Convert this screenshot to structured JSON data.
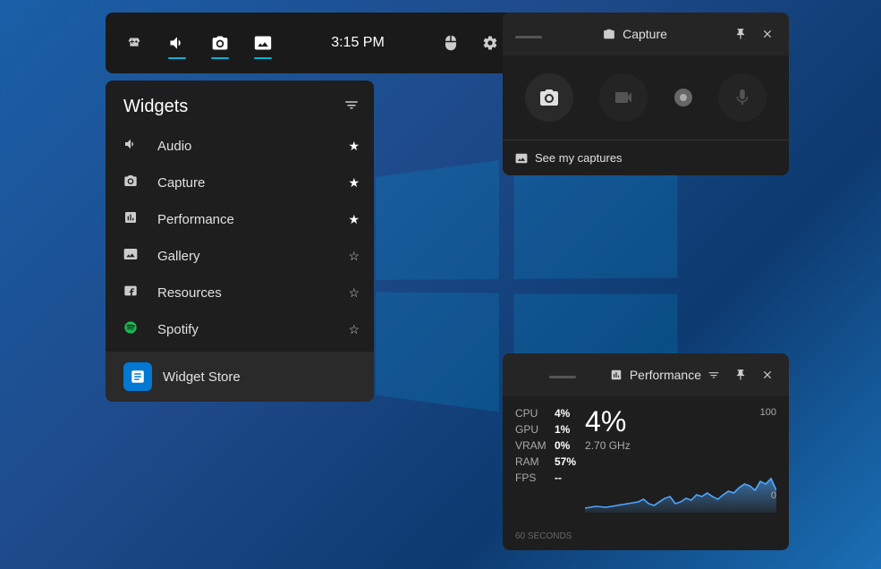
{
  "background": "#1a5fa8",
  "gamebar": {
    "icons": [
      {
        "name": "controller-icon",
        "symbol": "🎮",
        "active": false
      },
      {
        "name": "audio-icon",
        "symbol": "🔊",
        "active": true
      },
      {
        "name": "capture-icon",
        "symbol": "📷",
        "active": true
      },
      {
        "name": "gallery-icon",
        "symbol": "🖼",
        "active": true
      }
    ],
    "time": "3:15 PM",
    "mouse_icon": "🖱",
    "settings_icon": "⚙"
  },
  "widgets_panel": {
    "title": "Widgets",
    "settings_icon": "≡",
    "items": [
      {
        "id": "audio",
        "label": "Audio",
        "starred": true
      },
      {
        "id": "capture",
        "label": "Capture",
        "starred": true
      },
      {
        "id": "performance",
        "label": "Performance",
        "starred": true
      },
      {
        "id": "gallery",
        "label": "Gallery",
        "starred": false
      },
      {
        "id": "resources",
        "label": "Resources",
        "starred": false
      },
      {
        "id": "spotify",
        "label": "Spotify",
        "starred": false
      }
    ],
    "store_item": {
      "label": "Widget Store",
      "icon": "🏪"
    }
  },
  "capture_widget": {
    "title": "Capture",
    "controls": [
      {
        "name": "screenshot-btn",
        "symbol": "📷",
        "disabled": false
      },
      {
        "name": "record-btn",
        "symbol": "🎥",
        "disabled": true
      },
      {
        "name": "dot-btn",
        "symbol": "●",
        "disabled": false
      },
      {
        "name": "mic-btn",
        "symbol": "🎤",
        "disabled": true
      }
    ],
    "footer_text": "See my captures",
    "footer_icon": "🖼"
  },
  "performance_widget": {
    "title": "Performance",
    "stats": [
      {
        "label": "CPU",
        "value": "4%"
      },
      {
        "label": "GPU",
        "value": "1%"
      },
      {
        "label": "VRAM",
        "value": "0%"
      },
      {
        "label": "RAM",
        "value": "57%"
      },
      {
        "label": "FPS",
        "value": "--"
      }
    ],
    "percent": "4%",
    "ghz": "2.70 GHz",
    "chart_max": "100",
    "chart_zero": "0",
    "chart_label": "60 SECONDS"
  }
}
